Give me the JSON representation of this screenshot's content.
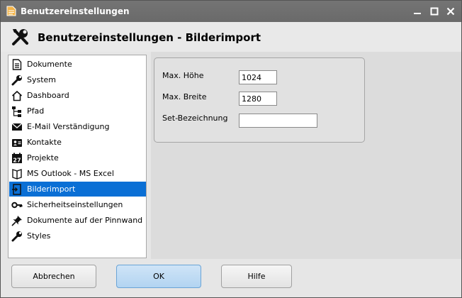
{
  "window": {
    "title": "Benutzereinstellungen",
    "header_title": "Benutzereinstellungen - Bilderimport"
  },
  "nav": {
    "selected": "Bilderimport",
    "items": [
      {
        "label": "Dokumente",
        "icon": "document-icon"
      },
      {
        "label": "System",
        "icon": "wrench-icon"
      },
      {
        "label": "Dashboard",
        "icon": "home-icon"
      },
      {
        "label": "Pfad",
        "icon": "tree-icon"
      },
      {
        "label": "E-Mail Verständigung",
        "icon": "mail-icon"
      },
      {
        "label": "Kontakte",
        "icon": "contact-card-icon"
      },
      {
        "label": "Projekte",
        "icon": "calendar-icon"
      },
      {
        "label": "MS Outlook - MS Excel",
        "icon": "book-icon"
      },
      {
        "label": "Bilderimport",
        "icon": "image-import-icon"
      },
      {
        "label": "Sicherheitseinstellungen",
        "icon": "key-icon"
      },
      {
        "label": "Dokumente auf der Pinnwand",
        "icon": "pin-icon"
      },
      {
        "label": "Styles",
        "icon": "wrench-icon"
      }
    ]
  },
  "form": {
    "max_height_label": "Max. Höhe",
    "max_height_value": "1024",
    "max_width_label": "Max. Breite",
    "max_width_value": "1280",
    "set_name_label": "Set-Bezeichnung",
    "set_name_value": ""
  },
  "buttons": {
    "cancel": "Abbrechen",
    "ok": "OK",
    "help": "Hilfe"
  },
  "colors": {
    "titlebar": "#6e6e6e",
    "selection": "#0a6fd5",
    "ok_button": "#b8d8f4"
  }
}
